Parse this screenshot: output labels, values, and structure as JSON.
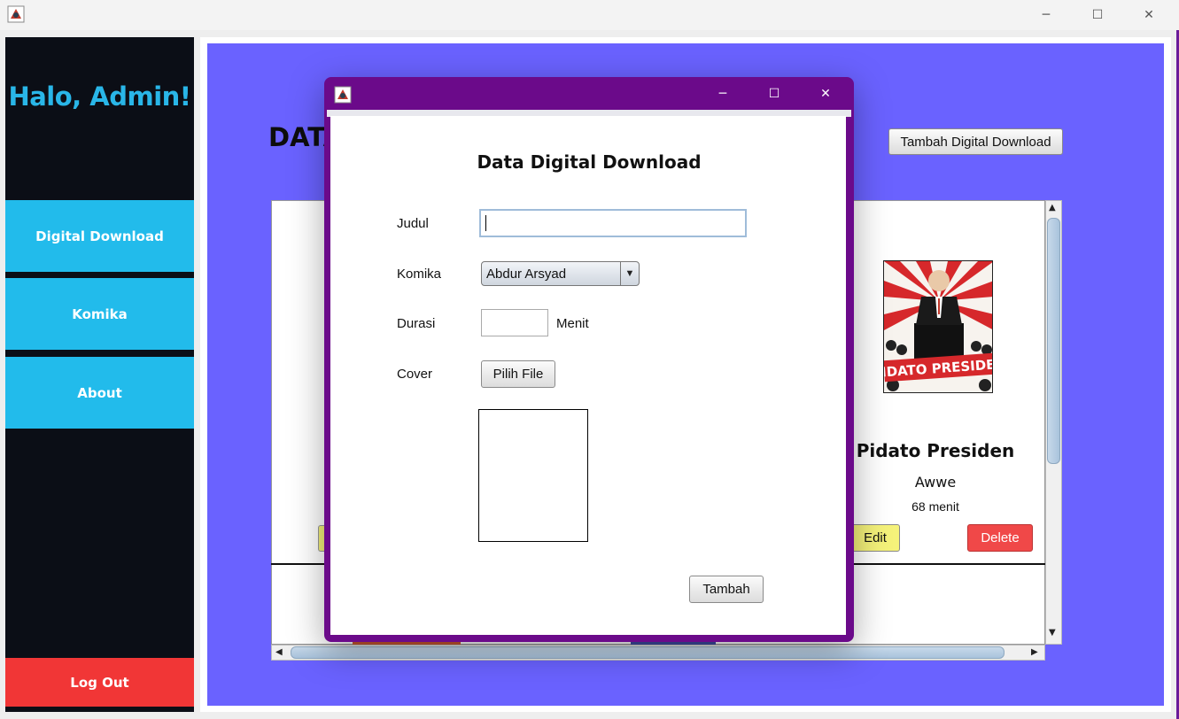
{
  "window": {
    "minimize": "─",
    "maximize": "☐",
    "close": "✕"
  },
  "sidebar": {
    "greeting": "Halo, Admin!",
    "items": [
      {
        "label": "Digital Download"
      },
      {
        "label": "Komika"
      },
      {
        "label": "About"
      }
    ],
    "logout": "Log Out"
  },
  "main": {
    "title": "DATA",
    "add_button": "Tambah Digital Download",
    "card": {
      "title": "Pidato Presiden",
      "komika": "Awwe",
      "durasi": "68 menit",
      "edit": "Edit",
      "delete": "Delete",
      "cover_text": "PIDATO PRESIDEN"
    }
  },
  "dialog": {
    "title": "Data Digital Download",
    "fields": {
      "judul_label": "Judul",
      "judul_value": "",
      "komika_label": "Komika",
      "komika_selected": "Abdur Arsyad",
      "durasi_label": "Durasi",
      "durasi_value": "",
      "durasi_unit": "Menit",
      "cover_label": "Cover",
      "pilih_file": "Pilih File"
    },
    "submit": "Tambah"
  },
  "colors": {
    "sidebar_bg": "#0b0e16",
    "nav_accent": "#22bbeb",
    "logout": "#f13636",
    "content_bg": "#6a62ff",
    "dialog_frame": "#6b0a8a",
    "edit_button": "#f5f27a",
    "delete_button": "#f04848"
  }
}
